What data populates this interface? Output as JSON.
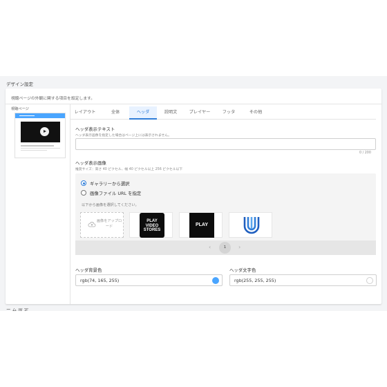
{
  "section": {
    "title": "デザイン設定",
    "next_title_partial": "ー ム 設 定"
  },
  "card": {
    "description": "視聴ページの外観に関する項目を設定します。"
  },
  "sidebar": {
    "label": "視聴ページ"
  },
  "tabs": [
    {
      "label": "レイアウト",
      "active": false
    },
    {
      "label": "全体",
      "active": false
    },
    {
      "label": "ヘッダ",
      "active": true
    },
    {
      "label": "説明文",
      "active": false
    },
    {
      "label": "プレイヤー",
      "active": false
    },
    {
      "label": "フッタ",
      "active": false
    },
    {
      "label": "その他",
      "active": false
    }
  ],
  "header_text": {
    "label": "ヘッダ表示テキスト",
    "hint": "ヘッダ表示画像を指定した場合はページ上には表示されません。",
    "value": "",
    "counter": "0 / 200"
  },
  "header_image": {
    "label": "ヘッダ表示画像",
    "hint": "推奨サイズ：高さ 40 ピクセル、幅 40 ピクセル以上 256 ピクセル以下",
    "options": [
      {
        "label": "ギャラリーから選択",
        "selected": true
      },
      {
        "label": "画像ファイル URL を指定",
        "selected": false
      }
    ],
    "select_hint": "以下から画像を選択してください。",
    "upload_label": "画像をアップロード",
    "gallery": [
      {
        "name": "play-video-stores-logo",
        "lines": [
          "PLAY",
          "VIDEO",
          "STORES"
        ]
      },
      {
        "name": "play-logo",
        "lines": [
          "PLAY"
        ]
      },
      {
        "name": "u-logo",
        "lines": []
      }
    ],
    "pagination": {
      "current": "1",
      "prev_icon": "chevron-left-icon",
      "next_icon": "chevron-right-icon"
    }
  },
  "bg_color": {
    "label": "ヘッダ背景色",
    "value": "rgb(74, 165, 255)",
    "swatch": "#4aa5ff"
  },
  "text_color": {
    "label": "ヘッダ文字色",
    "value": "rgb(255, 255, 255)",
    "swatch": "#ffffff"
  },
  "colors": {
    "accent": "#2f7dd8",
    "tab_active_bg": "#e8f2ff"
  }
}
